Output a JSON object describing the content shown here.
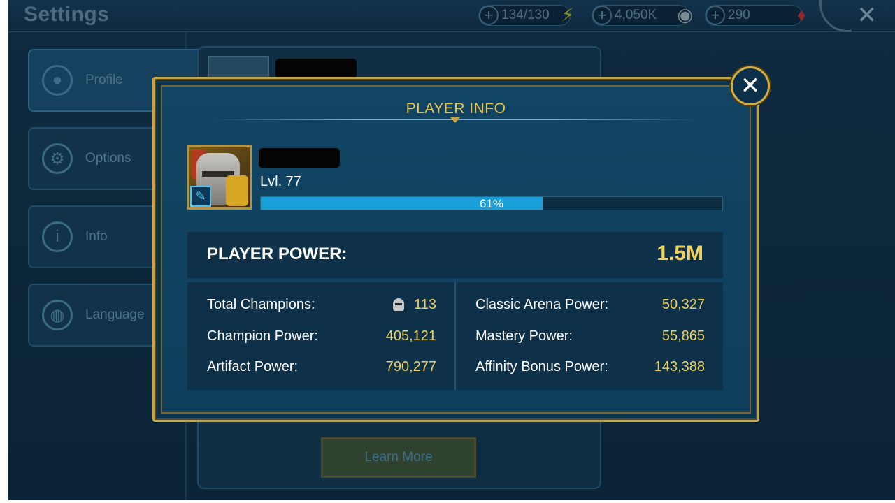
{
  "header": {
    "title": "Settings",
    "resources": [
      {
        "value": "134/130",
        "icon": "energy-icon"
      },
      {
        "value": "4,050K",
        "icon": "silver-coin-icon"
      },
      {
        "value": "290",
        "icon": "gem-icon"
      }
    ]
  },
  "sidebar": {
    "items": [
      {
        "label": "Profile",
        "icon": "person-icon"
      },
      {
        "label": "Options",
        "icon": "gear-icon"
      },
      {
        "label": "Info",
        "icon": "info-icon"
      },
      {
        "label": "Language",
        "icon": "globe-icon"
      }
    ]
  },
  "content": {
    "learn_more_label": "Learn More"
  },
  "modal": {
    "title": "PLAYER INFO",
    "level_text": "Lvl. 77",
    "xp_percent_text": "61%",
    "xp_fraction": 0.61,
    "power_label": "PLAYER POWER:",
    "power_value": "1.5M",
    "stats_left": [
      {
        "label": "Total Champions:",
        "value": "113"
      },
      {
        "label": "Champion Power:",
        "value": "405,121"
      },
      {
        "label": "Artifact Power:",
        "value": "790,277"
      }
    ],
    "stats_right": [
      {
        "label": "Classic Arena Power:",
        "value": "50,327"
      },
      {
        "label": "Mastery Power:",
        "value": "55,865"
      },
      {
        "label": "Affinity Bonus Power:",
        "value": "143,388"
      }
    ]
  },
  "colors": {
    "accent_gold": "#e8c64e",
    "value_yellow": "#eed25e",
    "xp_blue": "#1aa0d8"
  }
}
